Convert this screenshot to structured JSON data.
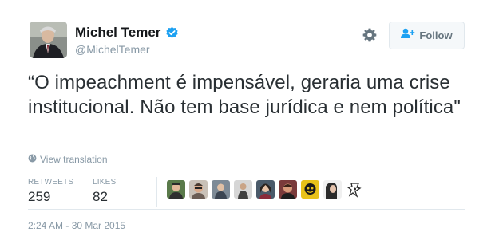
{
  "author": {
    "name": "Michel Temer",
    "handle": "@MichelTemer",
    "verified": true
  },
  "actions": {
    "follow_label": "Follow"
  },
  "tweet": {
    "text": "“O impeachment é impensável, geraria uma crise institucional. Não tem base jurídica e nem política\"",
    "translate_label": "View translation"
  },
  "stats": {
    "retweets_label": "RETWEETS",
    "retweets_value": "259",
    "likes_label": "LIKES",
    "likes_value": "82"
  },
  "likers": [
    {
      "icon": "user-avatar-1",
      "color": "#5a7a4a"
    },
    {
      "icon": "user-avatar-2",
      "color": "#6b5d55"
    },
    {
      "icon": "user-avatar-3",
      "color": "#7d8a96"
    },
    {
      "icon": "user-avatar-4",
      "color": "#3e3e3e"
    },
    {
      "icon": "user-avatar-5",
      "color": "#4a5a6a"
    },
    {
      "icon": "user-avatar-6",
      "color": "#7a3a3a"
    },
    {
      "icon": "user-avatar-7",
      "color": "#e8c21a"
    },
    {
      "icon": "user-avatar-8",
      "color": "#2b2b2b"
    },
    {
      "icon": "user-avatar-9",
      "color": "#ffffff"
    }
  ],
  "meta": {
    "timestamp": "2:24 AM - 30 Mar 2015"
  },
  "colors": {
    "verified_blue": "#1da1f2",
    "muted": "#8899a6",
    "text": "#292f33"
  }
}
